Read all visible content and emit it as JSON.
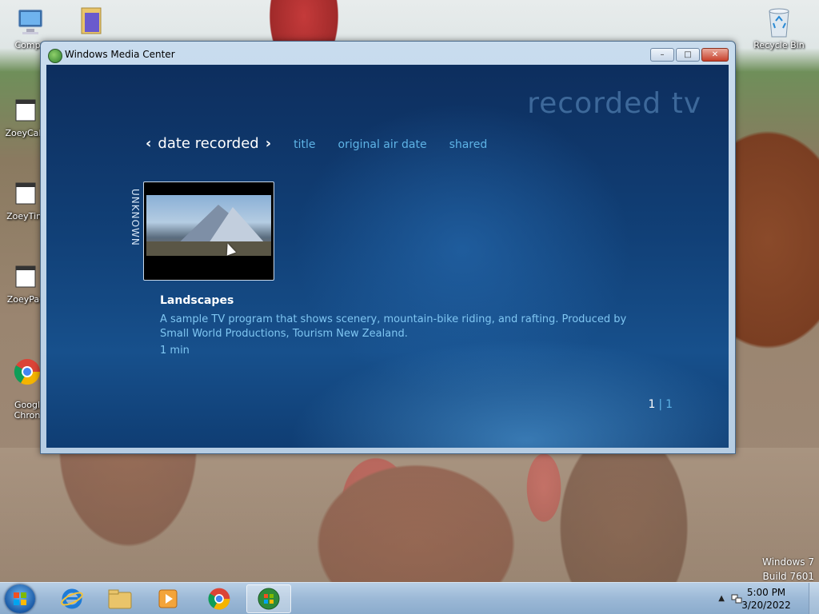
{
  "desktop": {
    "icons": [
      {
        "label": "Compu"
      },
      {
        "label": ""
      },
      {
        "label": "Recycle Bin"
      },
      {
        "label": "ZoeyCalc"
      },
      {
        "label": "ZoeyTim"
      },
      {
        "label": "ZoeyPac"
      },
      {
        "label": "Googl\nChron"
      }
    ],
    "watermark": {
      "line1": "Windows 7",
      "line2": "Build 7601"
    }
  },
  "window": {
    "title": "Windows Media Center",
    "minimize": "–",
    "restore": "□",
    "close": "✕"
  },
  "media_center": {
    "page_title": "recorded tv",
    "nav": {
      "prev": "‹",
      "current": "date recorded",
      "next": "›",
      "tabs": [
        "title",
        "original air date",
        "shared"
      ]
    },
    "group_label": "UNKNOWN",
    "selected_item": {
      "title": "Landscapes",
      "description": "A sample TV program that shows scenery, mountain-bike riding, and rafting. Produced by Small World Productions, Tourism New Zealand.",
      "duration": "1 min"
    },
    "pager": {
      "current": "1",
      "separator": "|",
      "total": "1"
    }
  },
  "taskbar": {
    "clock_time": "5:00 PM",
    "clock_date": "3/20/2022"
  }
}
